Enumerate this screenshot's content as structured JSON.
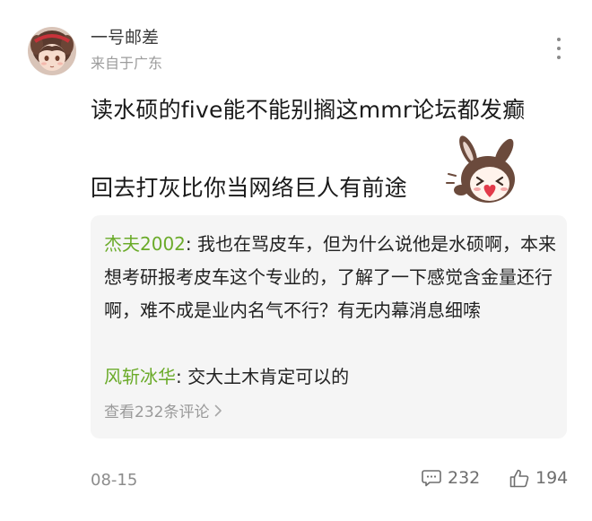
{
  "author": {
    "name": "一号邮差",
    "location": "来自于广东"
  },
  "post": {
    "line1": "读水硕的five能不能别搁这mmr论坛都发癫",
    "line2": "回去打灰比你当网络巨人有前途"
  },
  "comments": [
    {
      "author": "杰夫2002",
      "separator": ": ",
      "text": "我也在骂皮车，但为什么说他是水硕啊，本来想考研报考皮车这个专业的，了解了一下感觉含金量还行啊，难不成是业内名气不行？有无内幕消息细嗦"
    },
    {
      "author": "风斩冰华",
      "separator": ": ",
      "text": "交大土木肯定可以的"
    }
  ],
  "view_all_label": "查看232条评论",
  "footer": {
    "date": "08-15",
    "comment_count": "232",
    "like_count": "194"
  },
  "icons": {
    "more": "more-vertical-icon",
    "comment": "comment-icon",
    "like": "thumbs-up-icon",
    "chevron": "chevron-right-icon"
  },
  "colors": {
    "comment_author": "#6bab2a",
    "secondary_text": "#9a9a9a",
    "comment_box_bg": "#f5f5f5"
  }
}
